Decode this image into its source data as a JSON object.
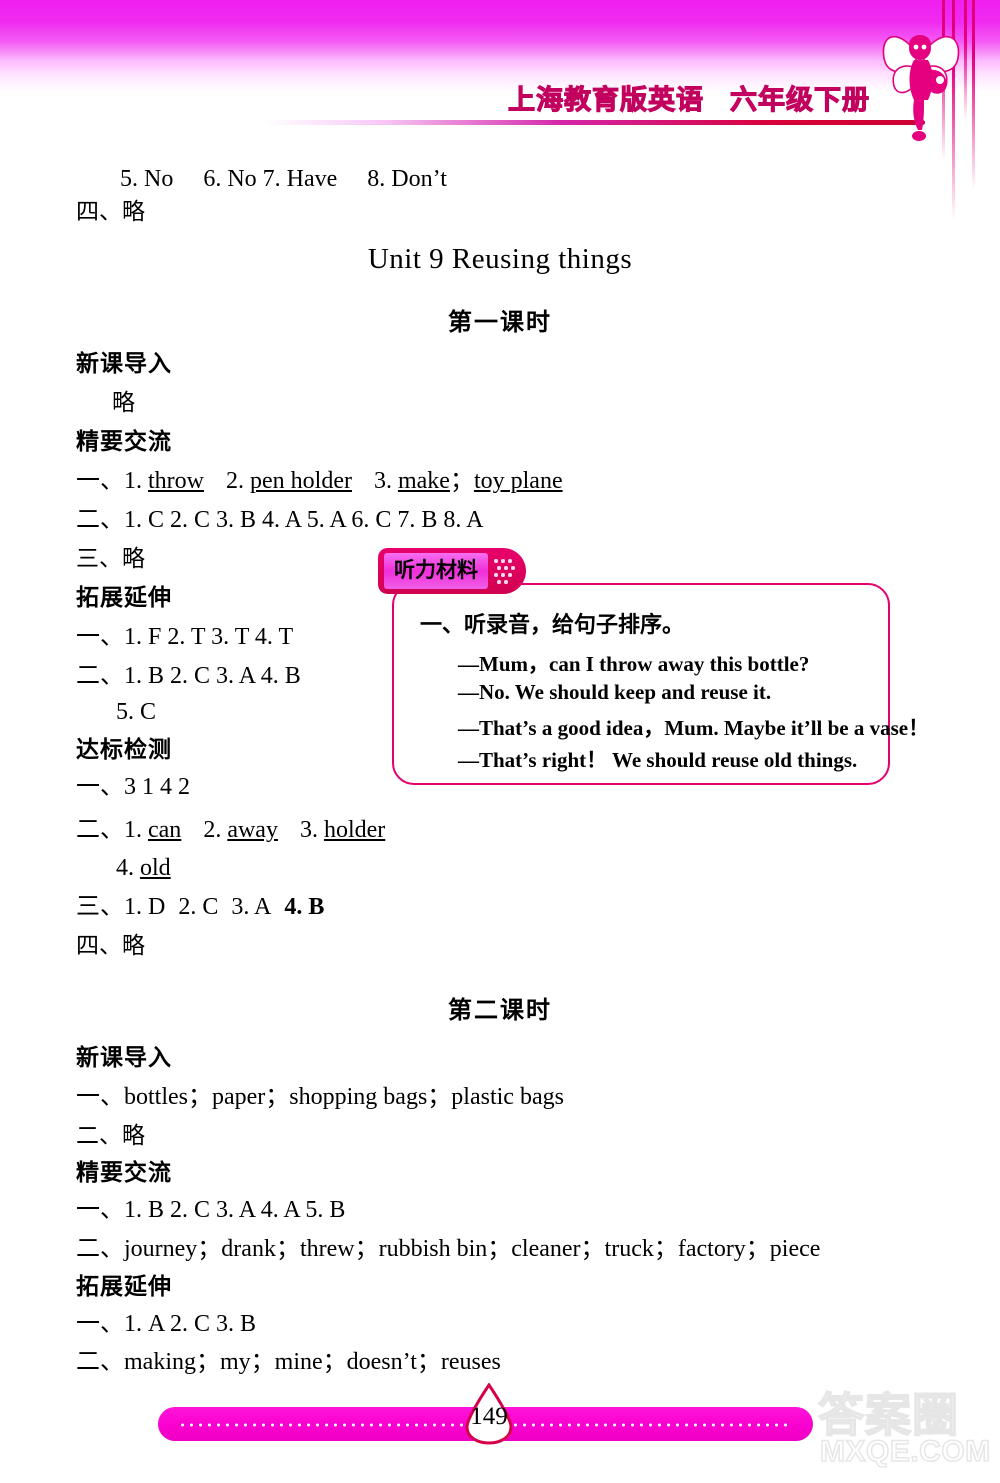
{
  "header": {
    "book_title_main": "上海教育版英语",
    "book_title_grade": "六年级下册",
    "mascot": "fairy-illustration"
  },
  "prev_section": {
    "answer_line": "5. No  6. No  7. Have  8. Don’t",
    "item_four": "四、略"
  },
  "unit": {
    "title": "Unit 9  Reusing things"
  },
  "lesson1": {
    "title": "第一课时",
    "sections": [
      {
        "heading": "新课导入",
        "lines": [
          "略"
        ]
      },
      {
        "heading": "精要交流",
        "lines": [
          "一、1. throw   2. pen holder   3. make；toy plane",
          "二、1. C  2. C  3. B  4. A  5. A  6. C  7. B  8. A",
          "三、略"
        ]
      },
      {
        "heading": "拓展延伸",
        "lines": [
          "一、1. F   2. T   3. T   4. T",
          "二、1. B  2. C  3. A  4. B",
          "5. C"
        ]
      },
      {
        "heading": "达标检测",
        "lines": [
          "一、3  1  4  2",
          "二、1. can   2. away   3. holder",
          "4. old",
          "三、1. D  2. C  3. A  4. B",
          "四、略"
        ]
      }
    ]
  },
  "listening_callout": {
    "tab_label": "听力材料",
    "question": "一、听录音，给句子排序。",
    "lines": [
      "—Mum，can I throw away this bottle?",
      "—No. We should keep and reuse it.",
      "—That’s a good idea，Mum. Maybe it’ll be a vase！",
      "—That’s right！ We should reuse old things."
    ]
  },
  "lesson2": {
    "title": "第二课时",
    "sections": [
      {
        "heading": "新课导入",
        "lines": [
          "一、bottles；paper；shopping bags；plastic bags",
          "二、略"
        ]
      },
      {
        "heading": "精要交流",
        "lines": [
          "一、1. B  2. C  3. A  4. A  5. B",
          "二、journey；drank；threw；rubbish bin；cleaner；truck；factory；piece"
        ]
      },
      {
        "heading": "拓展延伸",
        "lines": [
          "一、1. A  2. C  3. B",
          "二、making；my；mine；doesn’t；reuses"
        ]
      }
    ]
  },
  "footer": {
    "page_number": "149"
  },
  "watermark": {
    "chinese": "答案圈",
    "domain": "MXQE.COM"
  },
  "colors": {
    "magenta": "#ee22ee",
    "deep_pink": "#e4006e",
    "crimson_rule": "#cc0033",
    "title_pink": "#ff1493"
  }
}
